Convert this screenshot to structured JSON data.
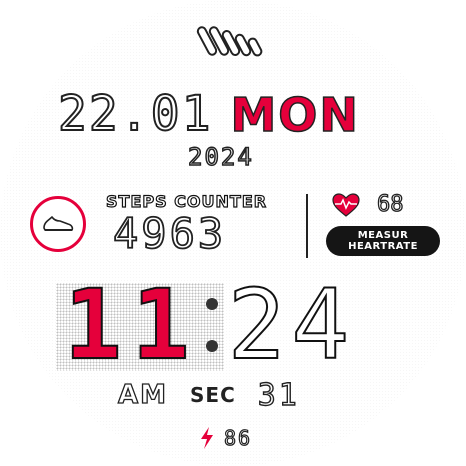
{
  "date": {
    "day_month": "22.01",
    "weekday": "MON",
    "year": "2024"
  },
  "steps": {
    "label": "STEPS COUNTER",
    "value": "4963",
    "icon": "sneaker-icon"
  },
  "heart_rate": {
    "value": "68",
    "button_line1": "MEASUR",
    "button_line2": "HEARTRATE",
    "icon": "heart-ecg-icon"
  },
  "time": {
    "hour": "11",
    "minute": "24",
    "ampm": "AM",
    "sec_label": "SEC",
    "sec_value": "31"
  },
  "battery": {
    "value": "86",
    "icon": "lightning-bolt-icon"
  },
  "colors": {
    "accent": "#e5003b",
    "ink": "#111111",
    "background": "#ffffff"
  }
}
